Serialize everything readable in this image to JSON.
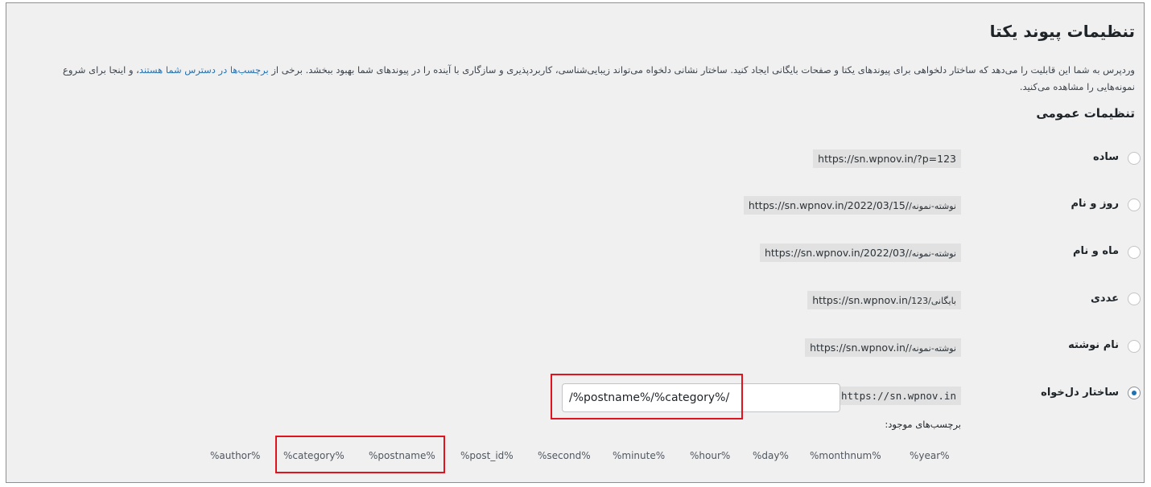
{
  "page": {
    "title": "تنظیمات پیوند یکتا",
    "intro_line1_part1": "وردپرس به شما این قابلیت را می‌دهد که ساختار دلخواهی برای پیوندهای یکتا و صفحات بایگانی ایجاد کنید. ساختار نشانی دلخواه می‌تواند زیبایی‌شناسی، کاربردپذیری و سازگاری با آینده را در پیوندهای شما بهبود ببخشد. برخی از",
    "intro_link": "برچسب‌ها در دسترس شما هستند",
    "intro_line1_part2": "، و اینجا برای شروع",
    "intro_line2": "نمونه‌هایی را مشاهده می‌کنید.",
    "section_title": "تنظیمات عمومی"
  },
  "options": [
    {
      "label": "ساده",
      "url_prefix": "https://sn.wpnov.in/?p=123",
      "url_slug": "",
      "checked": false
    },
    {
      "label": "روز و نام",
      "url_prefix": "https://sn.wpnov.in/2022/03/15/",
      "url_slug": "نوشته-نمونه/",
      "checked": false
    },
    {
      "label": "ماه و نام",
      "url_prefix": "https://sn.wpnov.in/2022/03/",
      "url_slug": "نوشته-نمونه/",
      "checked": false
    },
    {
      "label": "عددی",
      "url_prefix": "https://sn.wpnov.in/",
      "url_slug": "بایگانی/123",
      "checked": false
    },
    {
      "label": "نام نوشته",
      "url_prefix": "https://sn.wpnov.in/",
      "url_slug": "نوشته-نمونه/",
      "checked": false
    }
  ],
  "custom": {
    "label": "ساختار دل‌خواه",
    "host": "https://sn.wpnov.in",
    "value": "/%postname%/%category%/",
    "checked": true,
    "tags_label": "برچسب‌های موجود:"
  },
  "tags": [
    "%year%",
    "%monthnum%",
    "%day%",
    "%hour%",
    "%minute%",
    "%second%",
    "%post_id%",
    "%postname%",
    "%category%",
    "%author%"
  ],
  "colors": {
    "highlight": "#e0141e",
    "link": "#2271b1",
    "radio_checked": "#2271b1"
  }
}
